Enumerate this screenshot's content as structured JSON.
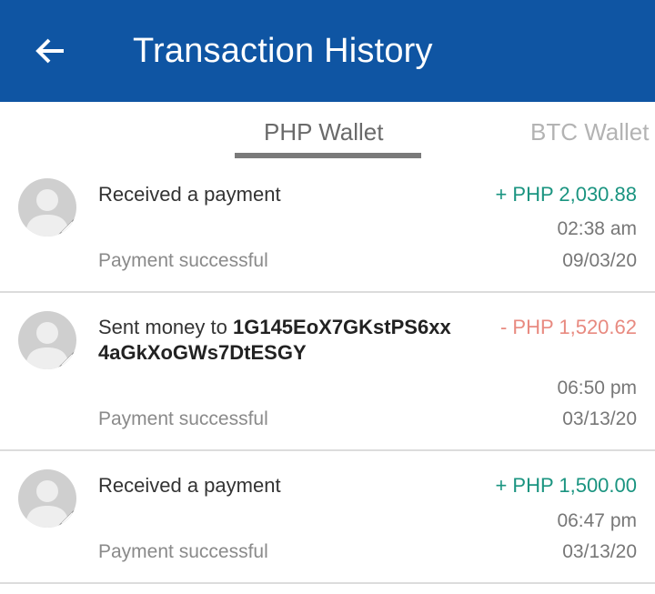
{
  "header": {
    "title": "Transaction History"
  },
  "tabs": [
    {
      "label": "PHP Wallet",
      "active": true
    },
    {
      "label": "BTC Wallet",
      "active": false
    }
  ],
  "transactions": [
    {
      "description": "Received a payment",
      "amount": "+ PHP 2,030.88",
      "time": "02:38 am",
      "date": "09/03/20",
      "status": "Payment successful",
      "direction": "incoming"
    },
    {
      "description_prefix": "Sent money to ",
      "address": "1G145EoX7GKstPS6xx 4aGkXoGWs7DtESGY",
      "amount": "- PHP 1,520.62",
      "time": "06:50 pm",
      "date": "03/13/20",
      "status": "Payment successful",
      "direction": "outgoing"
    },
    {
      "description": "Received a payment",
      "amount": "+ PHP 1,500.00",
      "time": "06:47 pm",
      "date": "03/13/20",
      "status": "Payment successful",
      "direction": "incoming"
    }
  ],
  "colors": {
    "appbar": "#0f55a3",
    "incoming": "#1a9480",
    "outgoing": "#e88a80"
  },
  "icons": {
    "back": "arrow-left-icon",
    "avatar": "user-avatar-icon"
  }
}
